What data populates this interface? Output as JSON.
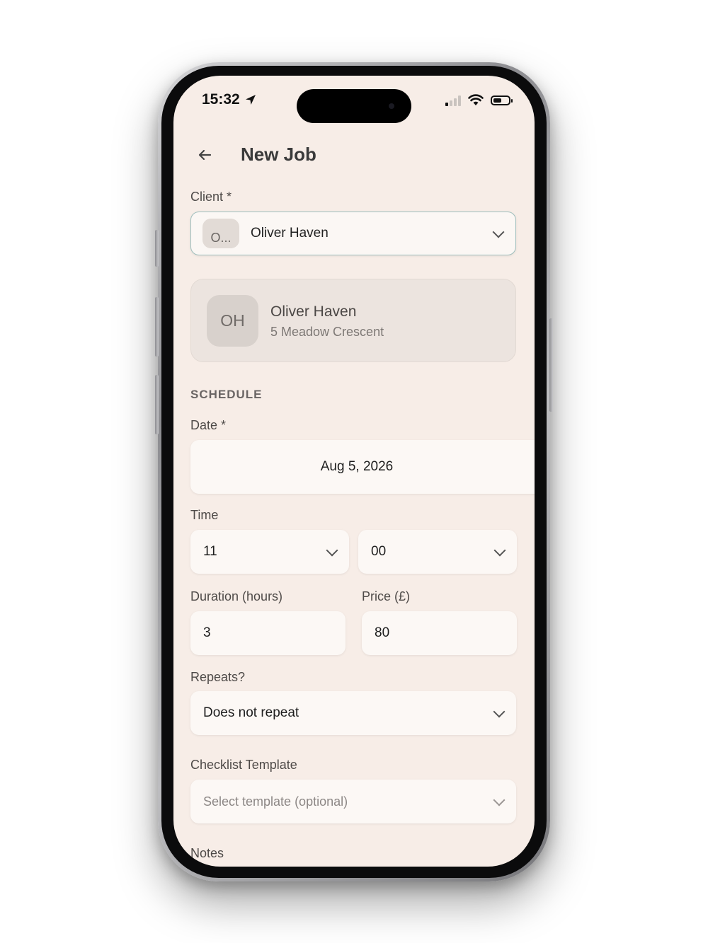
{
  "status_bar": {
    "time": "15:32",
    "signal_bars_on": 1,
    "battery_level": 0.55
  },
  "header": {
    "title": "New Job"
  },
  "client": {
    "label": "Client *",
    "selected_chip": "O...",
    "selected_name": "Oliver Haven",
    "card": {
      "initials": "OH",
      "name": "Oliver Haven",
      "address": "5 Meadow Crescent"
    }
  },
  "schedule": {
    "section_title": "SCHEDULE",
    "date_label": "Date *",
    "date_value": "Aug 5, 2026",
    "time_label": "Time",
    "hour_value": "11",
    "minute_value": "00"
  },
  "duration": {
    "label": "Duration (hours)",
    "value": "3"
  },
  "price": {
    "label": "Price (£)",
    "value": "80"
  },
  "repeats": {
    "label": "Repeats?",
    "value": "Does not repeat"
  },
  "checklist": {
    "label": "Checklist Template",
    "placeholder": "Select template (optional)"
  },
  "notes": {
    "label": "Notes"
  },
  "colors": {
    "screen_bg": "#f7ede7",
    "field_bg": "#fcf8f5",
    "client_border": "#9fbfbd"
  }
}
